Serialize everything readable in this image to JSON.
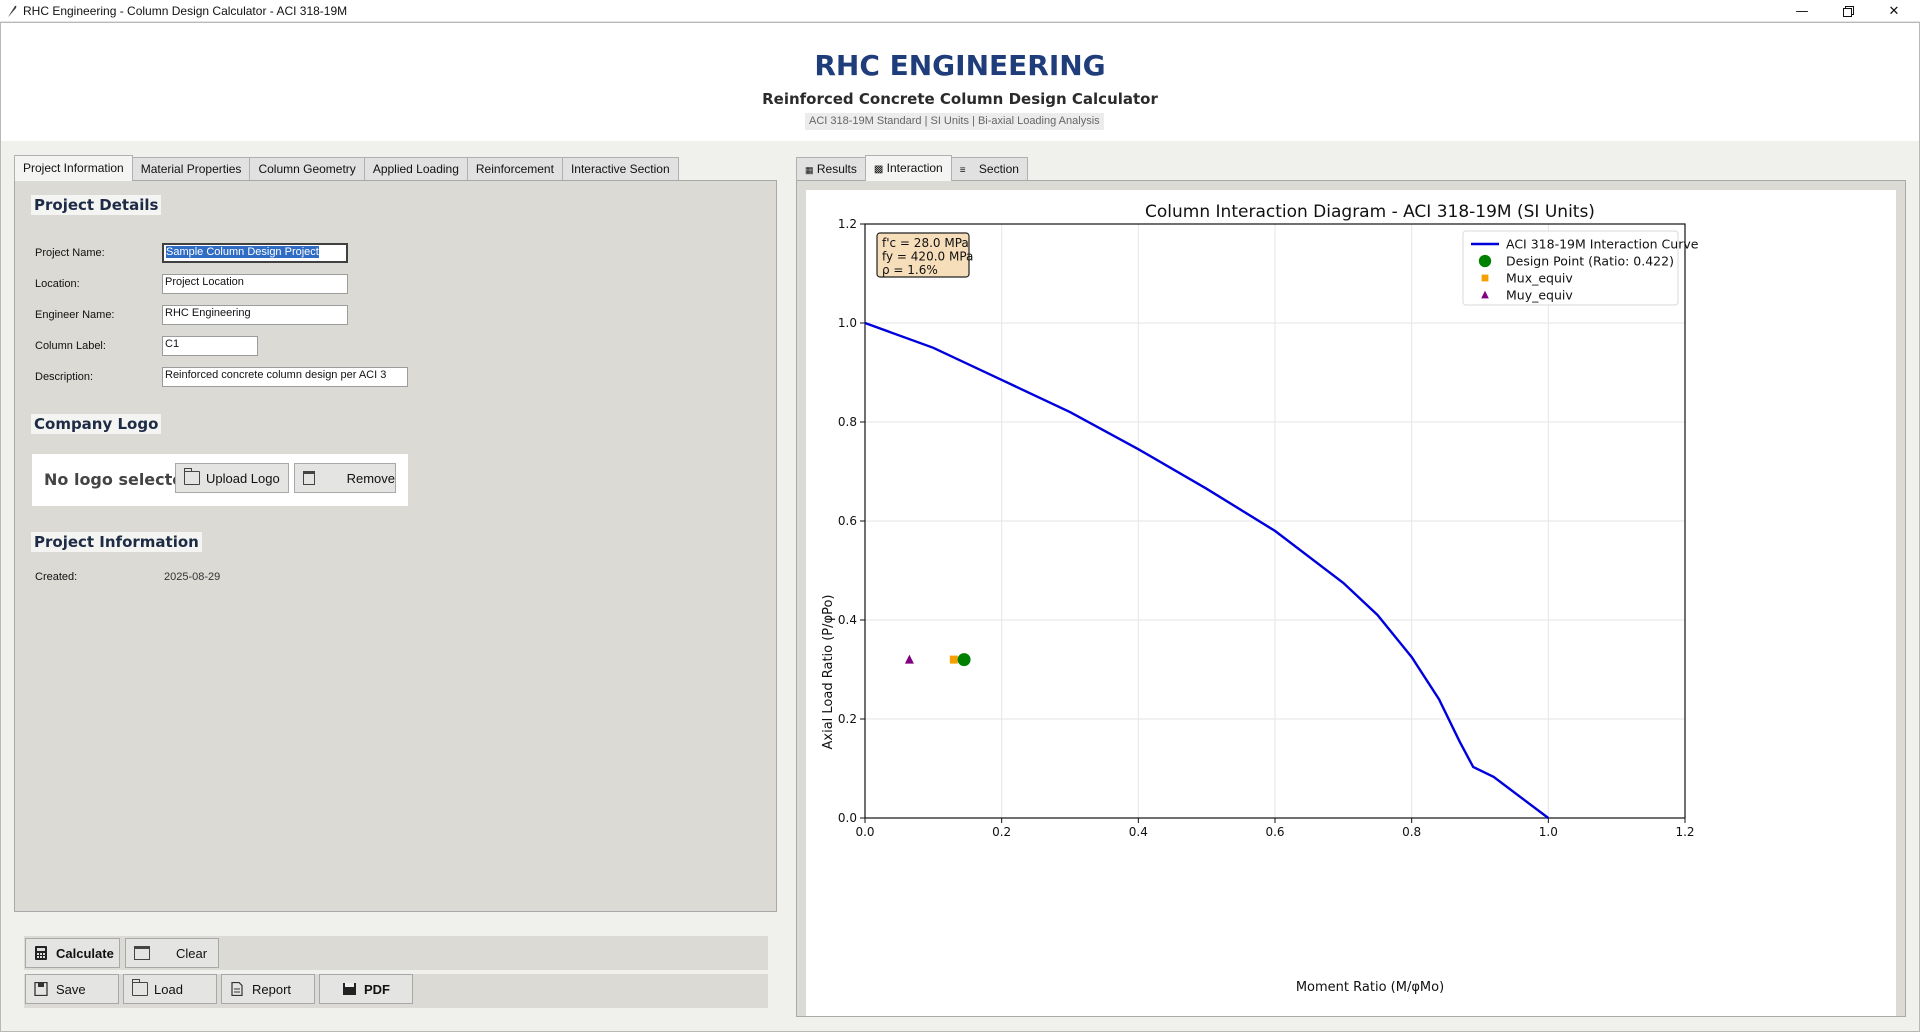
{
  "window": {
    "title": "RHC Engineering - Column Design Calculator - ACI 318-19M"
  },
  "header": {
    "brand": "RHC ENGINEERING",
    "subtitle": "Reinforced Concrete Column Design Calculator",
    "standard": "ACI 318-19M Standard | SI Units | Bi-axial Loading Analysis"
  },
  "left_tabs": [
    "Project Information",
    "Material Properties",
    "Column Geometry",
    "Applied Loading",
    "Reinforcement",
    "Interactive Section"
  ],
  "project_details": {
    "title": "Project Details",
    "fields": [
      {
        "label": "Project Name:",
        "value": "Sample Column Design Project"
      },
      {
        "label": "Location:",
        "value": "Project Location"
      },
      {
        "label": "Engineer Name:",
        "value": "RHC Engineering"
      },
      {
        "label": "Column Label:",
        "value": "C1"
      },
      {
        "label": "Description:",
        "value": "Reinforced concrete column design per ACI 3"
      }
    ]
  },
  "company_logo": {
    "title": "Company Logo",
    "status": "No logo selected",
    "upload_label": "Upload Logo",
    "remove_label": "Remove"
  },
  "project_info": {
    "title": "Project Information",
    "created_label": "Created:",
    "created_value": "2025-08-29"
  },
  "actions": {
    "calculate": "Calculate",
    "clear": "Clear",
    "save": "Save",
    "load": "Load",
    "report": "Report",
    "pdf": "PDF"
  },
  "right_tabs": [
    "Results",
    "Interaction",
    "Section"
  ],
  "chart_data": {
    "type": "line",
    "title": "Column Interaction Diagram - ACI 318-19M (SI Units)",
    "xlabel": "Moment Ratio (M/φMo)",
    "ylabel": "Axial Load Ratio (P/φPo)",
    "xlim": [
      0.0,
      1.2
    ],
    "ylim": [
      0.0,
      1.2
    ],
    "xticks": [
      "0.0",
      "0.2",
      "0.4",
      "0.6",
      "0.8",
      "1.0",
      "1.2"
    ],
    "yticks": [
      "0.0",
      "0.2",
      "0.4",
      "0.6",
      "0.8",
      "1.0",
      "1.2"
    ],
    "grid": true,
    "legend_position": "top-right",
    "info_box": [
      "f'c = 28.0 MPa",
      "fy = 420.0 MPa",
      "ρ = 1.6%"
    ],
    "series": [
      {
        "name": "ACI 318-19M Interaction Curve",
        "kind": "line",
        "color": "#0000dd",
        "x": [
          0.0,
          0.1,
          0.2,
          0.3,
          0.4,
          0.5,
          0.6,
          0.7,
          0.75,
          0.8,
          0.84,
          0.87,
          0.89,
          0.92,
          1.0
        ],
        "y": [
          1.0,
          0.95,
          0.885,
          0.82,
          0.745,
          0.665,
          0.58,
          0.475,
          0.41,
          0.325,
          0.24,
          0.155,
          0.103,
          0.083,
          0.0
        ]
      },
      {
        "name": "Design Point (Ratio: 0.422)",
        "kind": "marker",
        "marker": "circle",
        "color": "#008000",
        "x": [
          0.145
        ],
        "y": [
          0.32
        ]
      },
      {
        "name": "Mux_equiv",
        "kind": "marker",
        "marker": "square",
        "color": "#f5a000",
        "x": [
          0.13
        ],
        "y": [
          0.32
        ]
      },
      {
        "name": "Muy_equiv",
        "kind": "marker",
        "marker": "triangle",
        "color": "#800080",
        "x": [
          0.065
        ],
        "y": [
          0.32
        ]
      }
    ]
  }
}
